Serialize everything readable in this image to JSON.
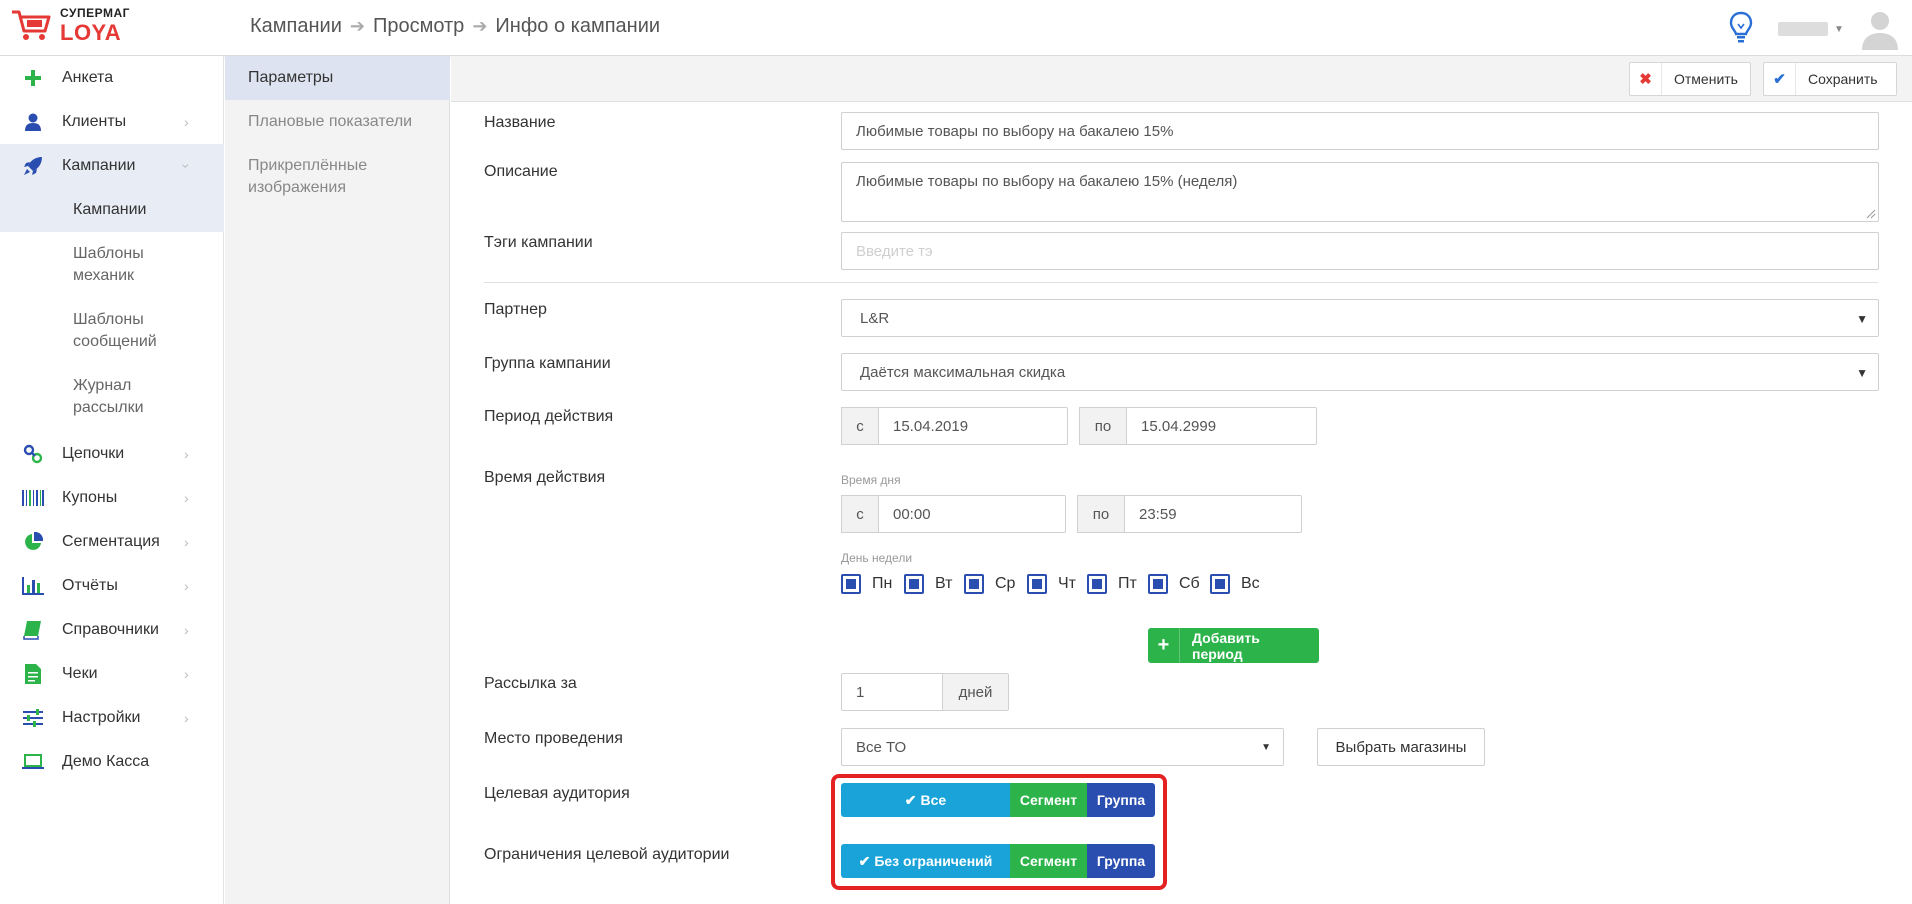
{
  "app": {
    "logo_top": "СУПЕРМАГ",
    "logo_bottom": "LOYA",
    "accent": "#e53935"
  },
  "breadcrumb": [
    "Кампании",
    "Просмотр",
    "Инфо о кампании"
  ],
  "sidebar": {
    "items": [
      {
        "label": "Анкета",
        "icon": "plus-icon"
      },
      {
        "label": "Клиенты",
        "icon": "user-icon"
      },
      {
        "label": "Кампании",
        "icon": "rocket-icon"
      },
      {
        "label": "Цепочки",
        "icon": "link-icon"
      },
      {
        "label": "Купоны",
        "icon": "barcode-icon"
      },
      {
        "label": "Сегментация",
        "icon": "pie-chart-icon"
      },
      {
        "label": "Отчёты",
        "icon": "bar-chart-icon"
      },
      {
        "label": "Справочники",
        "icon": "book-icon"
      },
      {
        "label": "Чеки",
        "icon": "document-icon"
      },
      {
        "label": "Настройки",
        "icon": "sliders-icon"
      },
      {
        "label": "Демо Касса",
        "icon": "laptop-icon"
      }
    ],
    "subitems": [
      {
        "label": "Кампании"
      },
      {
        "label": "Шаблоны механик"
      },
      {
        "label": "Шаблоны сообщений"
      },
      {
        "label": "Журнал рассылки"
      }
    ]
  },
  "subnav": {
    "items": [
      {
        "label": "Параметры"
      },
      {
        "label": "Плановые показатели"
      },
      {
        "label": "Прикреплённые изображения"
      }
    ]
  },
  "toolbar": {
    "cancel_label": "Отменить",
    "save_label": "Сохранить"
  },
  "form": {
    "name_label": "Название",
    "name_value": "Любимые товары по выбору на бакалею 15%",
    "description_label": "Описание",
    "description_value": "Любимые товары по выбору на бакалею 15% (неделя)",
    "tags_label": "Тэги кампании",
    "tags_placeholder": "Введите тэ",
    "partner_label": "Партнер",
    "partner_value": "L&R",
    "group_label": "Группа кампании",
    "group_value": "Даётся максимальная скидка",
    "period_label": "Период действия",
    "period_from_addon": "с",
    "period_from": "15.04.2019",
    "period_to_addon": "по",
    "period_to": "15.04.2999",
    "time_label": "Время действия",
    "time_of_day_hint": "Время дня",
    "time_from_addon": "с",
    "time_from": "00:00",
    "time_to_addon": "по",
    "time_to": "23:59",
    "weekday_hint": "День недели",
    "weekdays": [
      "Пн",
      "Вт",
      "Ср",
      "Чт",
      "Пт",
      "Сб",
      "Вс"
    ],
    "add_period_label": "Добавить период",
    "mailing_label": "Рассылка за",
    "mailing_value": "1",
    "mailing_unit": "дней",
    "venue_label": "Место проведения",
    "venue_value": "Все ТО",
    "choose_stores_label": "Выбрать магазины",
    "audience_label": "Целевая аудитория",
    "audience_options": [
      "Все",
      "Сегмент",
      "Группа"
    ],
    "restrictions_label": "Ограничения целевой аудитории",
    "restrictions_options": [
      "Без ограничений",
      "Сегмент",
      "Группа"
    ]
  },
  "colors": {
    "selected": "#1aa3d9",
    "green": "#2cb34a",
    "blue": "#2a4db0",
    "highlight": "#e52222"
  }
}
